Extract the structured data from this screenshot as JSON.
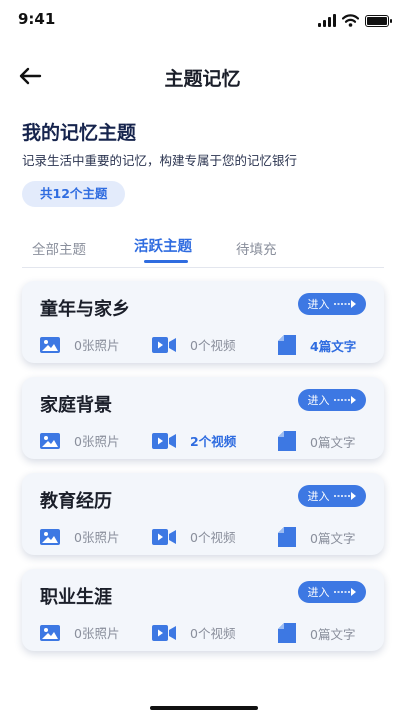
{
  "status_bar": {
    "time": "9:41"
  },
  "nav": {
    "title": "主题记忆"
  },
  "header": {
    "title": "我的记忆主题",
    "subtitle": "记录生活中重要的记忆，构建专属于您的记忆银行",
    "count": "共12个主题"
  },
  "tabs": [
    "全部主题",
    "活跃主题",
    "待填充"
  ],
  "colors": {
    "accent": "#2f6ce0",
    "button": "#3d78e3",
    "card_bg": "#f3f6fb"
  },
  "cards": [
    {
      "title": "童年与家乡",
      "enter": "进入",
      "photos": "0张照片",
      "videos": "0个视频",
      "texts": "4篇文字"
    },
    {
      "title": "家庭背景",
      "enter": "进入",
      "photos": "0张照片",
      "videos": "2个视频",
      "texts": "0篇文字"
    },
    {
      "title": "教育经历",
      "enter": "进入",
      "photos": "0张照片",
      "videos": "0个视频",
      "texts": "0篇文字"
    },
    {
      "title": "职业生涯",
      "enter": "进入",
      "photos": "0张照片",
      "videos": "0个视频",
      "texts": "0篇文字"
    }
  ]
}
